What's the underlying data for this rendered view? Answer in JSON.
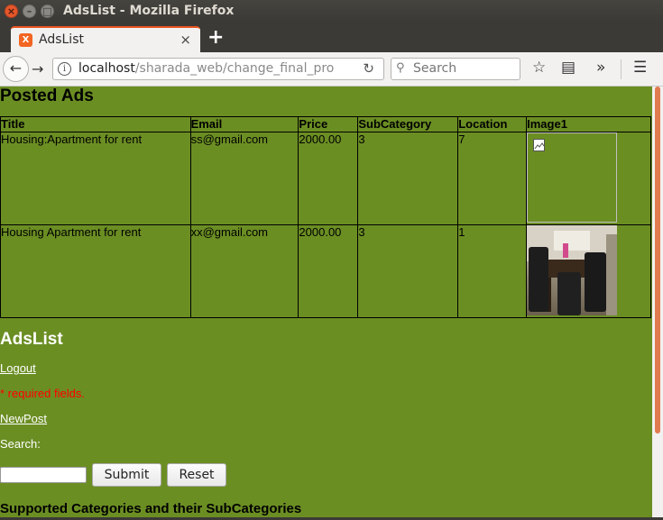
{
  "window": {
    "title": "AdsList - Mozilla Firefox",
    "controls": {
      "close": "×",
      "minimize": "–",
      "maximize": "□"
    }
  },
  "tab": {
    "label": "AdsList",
    "close": "×",
    "new_tab": "+",
    "favicon_letter": "X"
  },
  "navbar": {
    "url_host": "localhost",
    "url_path": "/sharada_web/change_final_pro",
    "search_placeholder": "Search",
    "icons": {
      "back": "back-arrow-icon",
      "forward": "forward-arrow-icon",
      "info": "info-icon",
      "reload": "reload-icon",
      "search": "search-icon",
      "bookmark": "star-icon",
      "reader": "reader-icon",
      "overflow": "overflow-chevron-icon",
      "menu": "hamburger-icon"
    }
  },
  "page": {
    "heading": "Posted Ads",
    "table": {
      "headers": [
        "Title",
        "Email",
        "Price",
        "SubCategory",
        "Location",
        "Image1"
      ],
      "rows": [
        {
          "title": "Housing:Apartment for rent",
          "email": "ss@gmail.com",
          "price": "2000.00",
          "subcategory": "3",
          "location": "7",
          "image": "broken-image-icon"
        },
        {
          "title": "Housing Apartment for rent",
          "email": "xx@gmail.com",
          "price": "2000.00",
          "subcategory": "3",
          "location": "1",
          "image": "dining-room-photo"
        }
      ]
    },
    "app_title": "AdsList",
    "logout": "Logout",
    "required": "* required fields.",
    "newpost": "NewPost",
    "search_label": "Search:",
    "search_value": "",
    "submit": "Submit",
    "reset": "Reset",
    "categories_heading": "Supported Categories and their SubCategories"
  },
  "colors": {
    "page_background": "#6b8e23",
    "required_text": "#ff0000",
    "tab_accent": "#e95420"
  }
}
